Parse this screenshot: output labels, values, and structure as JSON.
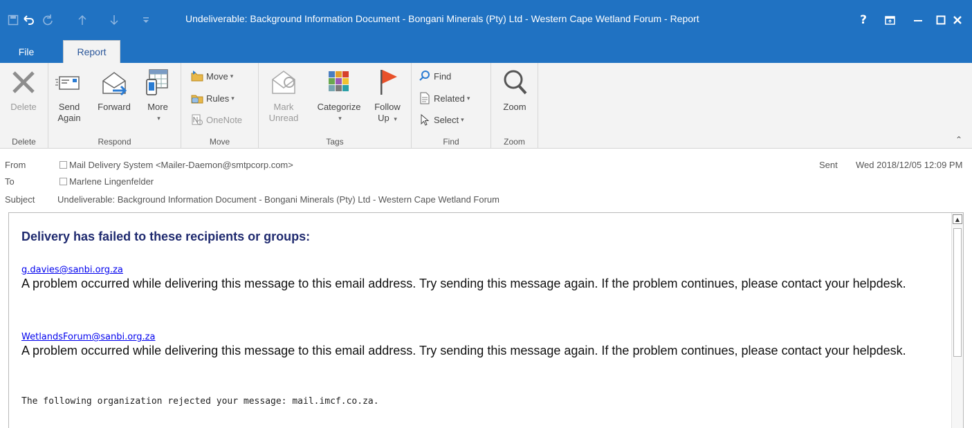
{
  "window": {
    "title": "Undeliverable: Background Information Document - Bongani Minerals (Pty) Ltd - Western Cape Wetland Forum - Report",
    "controls": {
      "help": "?",
      "restore_ribbon": "⊡",
      "minimize": "—",
      "maximize": "☐",
      "close": "✕"
    }
  },
  "qat": {
    "save": "save-icon",
    "undo": "undo-icon",
    "redo": "redo-icon",
    "up": "up-arrow-icon",
    "down": "down-arrow-icon",
    "customize": "customize-icon"
  },
  "tabs": [
    {
      "label": "File"
    },
    {
      "label": "Report"
    }
  ],
  "ribbon": {
    "groups": [
      {
        "label": "Delete"
      },
      {
        "label": "Respond"
      },
      {
        "label": "Move"
      },
      {
        "label": "Tags"
      },
      {
        "label": "Find"
      },
      {
        "label": "Zoom"
      }
    ],
    "delete": {
      "label": "Delete"
    },
    "send_again": {
      "line1": "Send",
      "line2": "Again"
    },
    "forward": {
      "label": "Forward"
    },
    "more": {
      "label": "More",
      "caret": "▾"
    },
    "move": {
      "label": "Move",
      "caret": "▾"
    },
    "rules": {
      "label": "Rules",
      "caret": "▾"
    },
    "onenote": {
      "label": "OneNote"
    },
    "mark_unread": {
      "line1": "Mark",
      "line2": "Unread"
    },
    "categorize": {
      "label": "Categorize",
      "caret": "▾"
    },
    "follow_up": {
      "line1": "Follow",
      "line2": "Up",
      "caret": "▾"
    },
    "find": {
      "label": "Find"
    },
    "related": {
      "label": "Related",
      "caret": "▾"
    },
    "select": {
      "label": "Select",
      "caret": "▾"
    },
    "zoom": {
      "label": "Zoom"
    },
    "collapse": "⌃"
  },
  "header": {
    "from_label": "From",
    "from_value": "Mail Delivery System <Mailer-Daemon@smtpcorp.com>",
    "to_label": "To",
    "to_value": "Marlene Lingenfelder",
    "subject_label": "Subject",
    "subject_value": "Undeliverable: Background Information Document - Bongani Minerals (Pty) Ltd - Western Cape Wetland Forum",
    "sent_label": "Sent",
    "sent_value": "Wed 2018/12/05 12:09 PM"
  },
  "body": {
    "heading": "Delivery has failed to these recipients or groups:",
    "recipients": [
      {
        "email": "g.davies@sanbi.org.za",
        "message": "A problem occurred while delivering this message to this email address. Try sending this message again. If the problem continues, please contact your helpdesk."
      },
      {
        "email": "WetlandsForum@sanbi.org.za",
        "message": "A problem occurred while delivering this message to this email address. Try sending this message again. If the problem continues, please contact your helpdesk."
      }
    ],
    "rejection_note": "The following organization rejected your message: mail.imcf.co.za."
  },
  "colors": {
    "titlebar": "#2072c2",
    "ribbon_bg": "#f3f3f3",
    "heading": "#1f2a6f",
    "link": "#0000ee",
    "follow_up_flag": "#e8512a"
  }
}
